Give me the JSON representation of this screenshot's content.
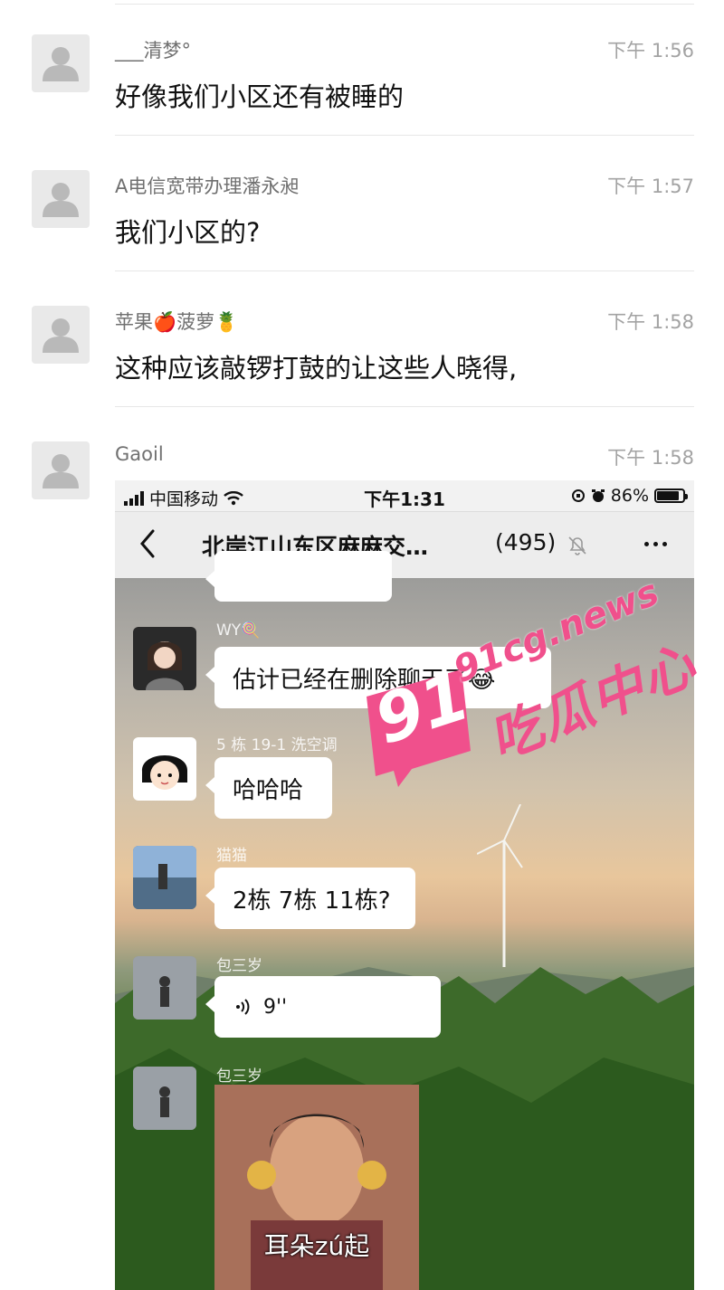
{
  "comments": [
    {
      "nickname": "___清梦°",
      "time": "下午 1:56",
      "text": "好像我们小区还有被睡的"
    },
    {
      "nickname": "A电信宽带办理潘永昶",
      "time": "下午 1:57",
      "text": "我们小区的?"
    },
    {
      "nickname": "苹果🍎菠萝🍍",
      "time": "下午 1:58",
      "text": "这种应该敲锣打鼓的让这些人晓得,"
    },
    {
      "nickname": "Gaoil",
      "time": "下午 1:58",
      "text": ""
    }
  ],
  "embedded_screenshot": {
    "status_bar": {
      "carrier": "中国移动",
      "time": "下午1:31",
      "battery": "86%",
      "battery_level": 0.86
    },
    "chat_header": {
      "title": "北岸江山东区麻麻交…",
      "member_count": "(495)"
    },
    "messages": [
      {
        "sender": "WY🍭",
        "text": "估计已经在删除聊天了😂"
      },
      {
        "sender": "5 栋 19-1 洗空调",
        "text": "哈哈哈"
      },
      {
        "sender": "猫猫",
        "text": "2栋 7栋 11栋?"
      },
      {
        "sender": "包三岁",
        "voice_duration": "9''"
      },
      {
        "sender": "包三岁",
        "sticker_caption": "耳朵zú起"
      }
    ]
  },
  "watermark": {
    "number": "91",
    "domain": "91cg.news",
    "name": "吃瓜中心"
  }
}
